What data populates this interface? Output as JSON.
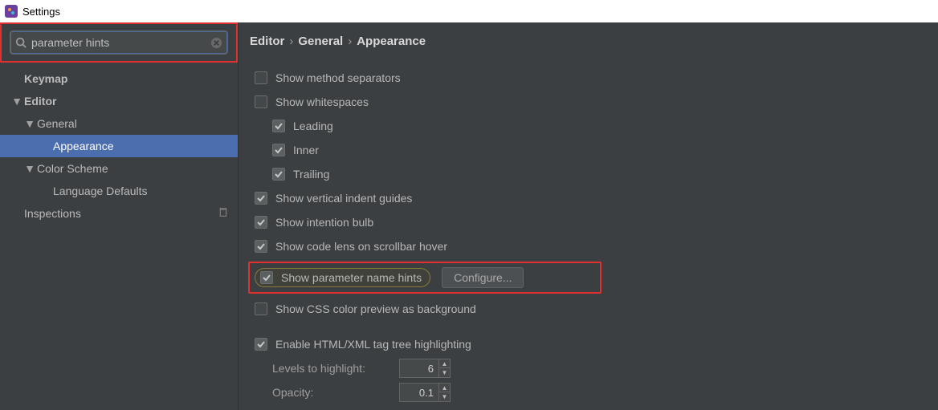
{
  "window": {
    "title": "Settings"
  },
  "search": {
    "value": "parameter hints",
    "placeholder": ""
  },
  "sidebar": {
    "items": [
      {
        "label": "Keymap",
        "bold": true,
        "indent": 1
      },
      {
        "label": "Editor",
        "bold": true,
        "indent": 0,
        "expanded": true
      },
      {
        "label": "General",
        "indent": 1,
        "expanded": true
      },
      {
        "label": "Appearance",
        "indent": 2,
        "selected": true
      },
      {
        "label": "Color Scheme",
        "indent": 1,
        "expanded": true
      },
      {
        "label": "Language Defaults",
        "indent": 2
      },
      {
        "label": "Inspections",
        "indent": 1,
        "copy": true
      }
    ]
  },
  "breadcrumb": {
    "a": "Editor",
    "b": "General",
    "c": "Appearance"
  },
  "options": {
    "method_separators": {
      "label": "Show method separators",
      "checked": false
    },
    "whitespaces": {
      "label": "Show whitespaces",
      "checked": false
    },
    "leading": {
      "label": "Leading",
      "checked": true
    },
    "inner": {
      "label": "Inner",
      "checked": true
    },
    "trailing": {
      "label": "Trailing",
      "checked": true
    },
    "vertical_guides": {
      "label": "Show vertical indent guides",
      "checked": true
    },
    "intention_bulb": {
      "label": "Show intention bulb",
      "checked": true
    },
    "code_lens": {
      "label": "Show code lens on scrollbar hover",
      "checked": true
    },
    "param_hints": {
      "label": "Show parameter name hints",
      "checked": true,
      "configure": "Configure..."
    },
    "css_preview": {
      "label": "Show CSS color preview as background",
      "checked": false
    },
    "html_tree": {
      "label": "Enable HTML/XML tag tree highlighting",
      "checked": true
    },
    "levels": {
      "label": "Levels to highlight:",
      "value": "6"
    },
    "opacity": {
      "label": "Opacity:",
      "value": "0.1"
    }
  }
}
